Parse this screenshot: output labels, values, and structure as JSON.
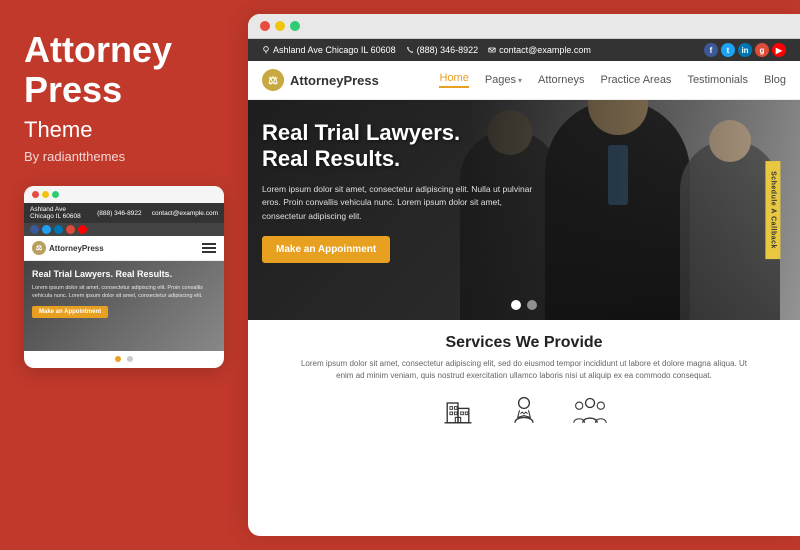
{
  "left": {
    "title_line1": "Attorney",
    "title_line2": "Press",
    "subtitle": "Theme",
    "by": "By radiantthemes"
  },
  "mobile": {
    "topbar": {
      "location": "Ashland Ave Chicago IL 60608",
      "phone": "(888) 346-8922",
      "email": "contact@example.com"
    },
    "logo": "AttorneyPress",
    "hero_title": "Real Trial Lawyers. Real Results.",
    "hero_text": "Lorem ipsum dolor sit amet, consectetur adipiscing elit. Proin convallis vehicula nunc. Lorem ipsum dolor sit amet, consectetur adipiscing elit.",
    "cta": "Make an Appointment"
  },
  "desktop": {
    "topbar": {
      "location": "Ashland Ave Chicago IL 60608",
      "phone": "(888) 346-8922",
      "email": "contact@example.com"
    },
    "logo": "AttorneyPress",
    "nav": {
      "items": [
        {
          "label": "Home",
          "active": true,
          "has_dropdown": false
        },
        {
          "label": "Pages",
          "active": false,
          "has_dropdown": true
        },
        {
          "label": "Attorneys",
          "active": false,
          "has_dropdown": false
        },
        {
          "label": "Practice Areas",
          "active": false,
          "has_dropdown": false
        },
        {
          "label": "Testimonials",
          "active": false,
          "has_dropdown": false
        },
        {
          "label": "Blog",
          "active": false,
          "has_dropdown": false
        }
      ]
    },
    "hero": {
      "title_line1": "Real Trial Lawyers.",
      "title_line2": "Real Results.",
      "text": "Lorem ipsum dolor sit amet, consectetur adipiscing elit. Nulla ut pulvinar eros. Proin convallis vehicula nunc. Lorem ipsum dolor sit amet, consectetur adipiscing elit.",
      "cta": "Make an Appoinment",
      "schedule_tab": "Schedule A Callback"
    },
    "services": {
      "title": "Services We Provide",
      "desc": "Lorem ipsum dolor sit amet, consectetur adipiscing elit, sed do eiusmod tempor incididunt ut labore et dolore magna aliqua. Ut enim ad minim veniam, quis nostrud exercitation ullamco laboris nisi ut aliquip ex ea commodo consequat.",
      "icons": [
        {
          "name": "building-icon"
        },
        {
          "name": "lawyer-icon"
        },
        {
          "name": "group-icon"
        }
      ]
    }
  },
  "social_colors": {
    "facebook": "#3b5998",
    "twitter": "#1da1f2",
    "linkedin": "#0077b5",
    "google": "#dd4b39",
    "youtube": "#ff0000"
  }
}
